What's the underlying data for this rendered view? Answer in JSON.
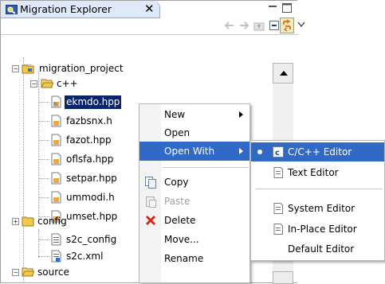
{
  "view": {
    "title": "Migration Explorer",
    "close_symbol": "✕",
    "icons": {
      "tab": "explorer-view-icon",
      "minimize": "minimize-icon",
      "maximize": "maximize-icon",
      "back": "back-arrow-icon",
      "forward": "forward-arrow-icon",
      "up": "up-folder-icon",
      "collapse_all": "collapse-all-icon",
      "link_with_editor": "link-with-editor-icon",
      "view_menu": "view-menu-icon"
    }
  },
  "tree": {
    "project": {
      "label": "migration_project",
      "expander": "−"
    },
    "folders": [
      {
        "label": "c++",
        "expander": "−"
      },
      {
        "label": "config",
        "expander": "+"
      },
      {
        "label": "source",
        "expander": "−"
      }
    ],
    "cpp_files": [
      "ekmdo.hpp",
      "fazbsnx.h",
      "fazot.hpp",
      "oflsfa.hpp",
      "setpar.hpp",
      "ummodi.h",
      "umset.hpp"
    ],
    "config_files": [
      "s2c_config",
      "s2c.xml"
    ],
    "selected_file_index": 0
  },
  "context_menu": {
    "items": [
      {
        "label": "New",
        "has_submenu": true
      },
      {
        "label": "Open"
      },
      {
        "label": "Open With",
        "has_submenu": true,
        "highlighted": true
      },
      {
        "label": "Copy",
        "icon": "copy-icon"
      },
      {
        "label": "Paste",
        "icon": "paste-icon",
        "disabled": true
      },
      {
        "label": "Delete",
        "icon": "delete-icon"
      },
      {
        "label": "Move..."
      },
      {
        "label": "Rename"
      }
    ]
  },
  "open_with_menu": {
    "items": [
      {
        "label": "C/C++ Editor",
        "icon": "c-editor-icon",
        "checked": true,
        "highlighted": true
      },
      {
        "label": "Text Editor",
        "icon": "text-editor-icon"
      },
      {
        "label": "System Editor",
        "icon": "system-editor-icon"
      },
      {
        "label": "In-Place Editor",
        "icon": "in-place-editor-icon"
      },
      {
        "label": "Default Editor"
      }
    ]
  },
  "colors": {
    "selection": "#0a246a",
    "menu_highlight": "#3169c6",
    "tab_background": "#dfe9f7",
    "folder_yellow": "#f2c94c",
    "delete_red": "#d9261c"
  }
}
